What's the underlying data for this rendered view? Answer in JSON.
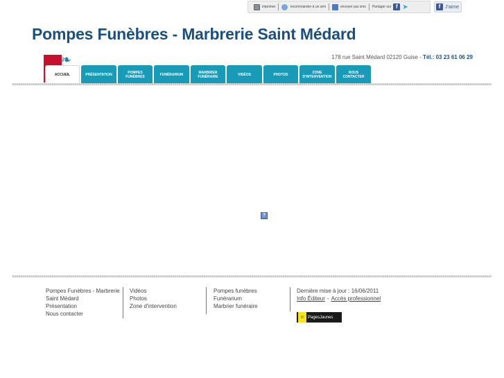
{
  "toolbar": {
    "print": "imprimer",
    "recommend": "recommander à un ami",
    "send": "envoyer par sms",
    "share": "Partager sur",
    "like": "J'aime"
  },
  "header": {
    "title": "Pompes Funèbres - Marbrerie Saint Médard",
    "address": "178 rue Saint Médard 02120 Guise",
    "separator": " - ",
    "tel": "Tél.: 03 23 61 06 29"
  },
  "nav": {
    "items": [
      {
        "label": "ACCUEIL"
      },
      {
        "label": "PRÉSENTATION"
      },
      {
        "label": "POMPES FUNÈBRES"
      },
      {
        "label": "FUNÉRARIUM"
      },
      {
        "label": "MARBRIER FUNÉRAIRE"
      },
      {
        "label": "VIDÉOS"
      },
      {
        "label": "PHOTOS"
      },
      {
        "label": "ZONE D'INTERVENTION"
      },
      {
        "label": "NOUS CONTACTER"
      }
    ]
  },
  "footer": {
    "col1": [
      "Pompes Funèbres - Marbrerie",
      "Saint Médard",
      "Présentation",
      "Nous contacter"
    ],
    "col2": [
      "Vidéos",
      "Photos",
      "Zone d'intervention"
    ],
    "col3": [
      "Pompes funèbres",
      "Funérarium",
      "Marbrier funéraire"
    ],
    "last_update": "Dernière mise à jour : 16/06/2011",
    "info_editor": "Info Éditeur",
    "dash": "-",
    "pro_access": "Accès professionnel",
    "pages_jaunes": "PagesJaunes"
  },
  "colors": {
    "title": "#1a5080",
    "nav_tab": "#179bb6",
    "logo_red": "#c8102e"
  }
}
